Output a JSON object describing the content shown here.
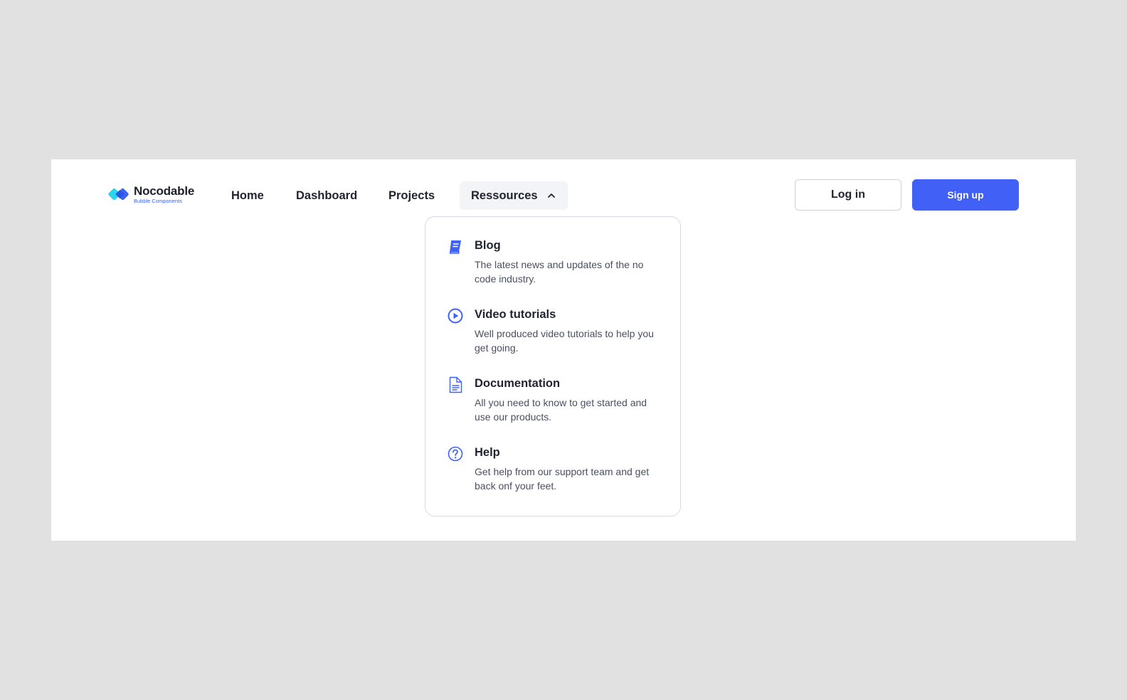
{
  "brand": {
    "name": "Nocodable",
    "tagline": "Bubble Components",
    "colors": {
      "primary": "#4160f6",
      "logo_cyan": "#2ed3f0",
      "logo_blue": "#3d63f5"
    }
  },
  "nav": {
    "items": [
      {
        "label": "Home"
      },
      {
        "label": "Dashboard"
      },
      {
        "label": "Projects"
      },
      {
        "label": "Ressources",
        "expanded": true,
        "icon": "chevron-up-icon"
      }
    ]
  },
  "auth": {
    "login_label": "Log in",
    "signup_label": "Sign up"
  },
  "dropdown": {
    "items": [
      {
        "title": "Blog",
        "description": "The latest news and updates of the no code industry.",
        "icon": "book-icon"
      },
      {
        "title": "Video tutorials",
        "description": "Well produced video tutorials to help you get going.",
        "icon": "play-circle-icon"
      },
      {
        "title": "Documentation",
        "description": "All you need to know to get started and use our products.",
        "icon": "document-icon"
      },
      {
        "title": "Help",
        "description": "Get help from our support team and get back onf your feet.",
        "icon": "question-circle-icon"
      }
    ]
  }
}
